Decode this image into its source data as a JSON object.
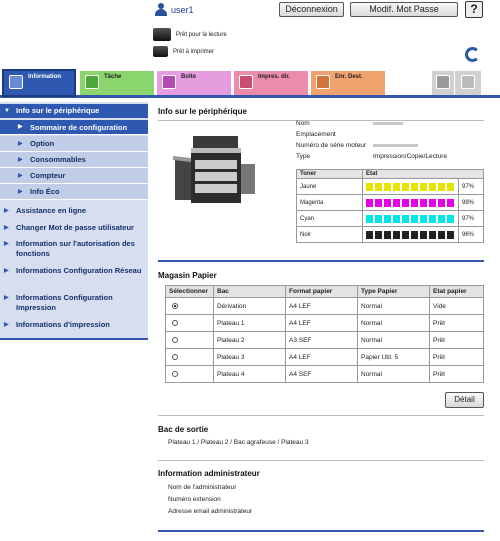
{
  "header": {
    "user": "user1",
    "logout": "Déconnexion",
    "change_password": "Modif. Mot Passe",
    "help": "?",
    "status_reading": "Prêt pour la lecture",
    "status_printing": "Prêt à imprimer"
  },
  "tabs": [
    {
      "label": "Information"
    },
    {
      "label": "Tâche"
    },
    {
      "label": "Boîte"
    },
    {
      "label": "Impres. dir."
    },
    {
      "label": "Enr. Dest."
    }
  ],
  "sidebar": {
    "items": [
      {
        "label": "Info sur le périphérique"
      },
      {
        "label": "Sommaire de configuration"
      },
      {
        "label": "Option"
      },
      {
        "label": "Consommables"
      },
      {
        "label": "Compteur"
      },
      {
        "label": "Info Éco"
      },
      {
        "label": "Assistance en ligne"
      },
      {
        "label": "Changer Mot de passe utilisateur"
      },
      {
        "label": "Information sur l'autorisation des fonctions"
      },
      {
        "label": "Informations Configuration Réseau"
      },
      {
        "label": "Informations Configuration Impression"
      },
      {
        "label": "Informations d'impression"
      }
    ]
  },
  "device": {
    "title": "Info sur le périphérique",
    "name_label": "Nom",
    "location_label": "Emplacement",
    "serial_label": "Numéro de série moteur",
    "type_label": "Type",
    "type_value": "Impression/Copie/Lecture"
  },
  "toner": {
    "col_toner": "Toner",
    "col_state": "Etat",
    "rows": [
      {
        "name": "Jaune",
        "color": "#e6e600",
        "level": 0.97,
        "pct": "97%"
      },
      {
        "name": "Magenta",
        "color": "#e600e6",
        "level": 0.98,
        "pct": "98%"
      },
      {
        "name": "Cyan",
        "color": "#00e6e6",
        "level": 0.97,
        "pct": "97%"
      },
      {
        "name": "Noir",
        "color": "#222222",
        "level": 0.96,
        "pct": "96%"
      }
    ]
  },
  "paper": {
    "title": "Magasin Papier",
    "headers": [
      "Sélectionner",
      "Bac",
      "Format papier",
      "Type Papier",
      "Etat papier"
    ],
    "rows": [
      {
        "selected": true,
        "tray": "Dérivation",
        "size": "A4 LEF",
        "type": "Normal",
        "state": "Vide"
      },
      {
        "selected": false,
        "tray": "Plateau 1",
        "size": "A4 LEF",
        "type": "Normal",
        "state": "Prêt"
      },
      {
        "selected": false,
        "tray": "Plateau 2",
        "size": "A3 SEF",
        "type": "Normal",
        "state": "Prêt"
      },
      {
        "selected": false,
        "tray": "Plateau 3",
        "size": "A4 LEF",
        "type": "Papier Util. 5",
        "state": "Prêt"
      },
      {
        "selected": false,
        "tray": "Plateau 4",
        "size": "A4 SEF",
        "type": "Normal",
        "state": "Prêt"
      }
    ],
    "detail_button": "Détail"
  },
  "output": {
    "title": "Bac de sortie",
    "value": "Plateau 1 / Plateau 2 / Bac agrafeuse / Plateau 3"
  },
  "admin": {
    "title": "Information administrateur",
    "name_label": "Nom de l'administrateur",
    "ext_label": "Numéro extension",
    "email_label": "Adresse email administrateur"
  }
}
